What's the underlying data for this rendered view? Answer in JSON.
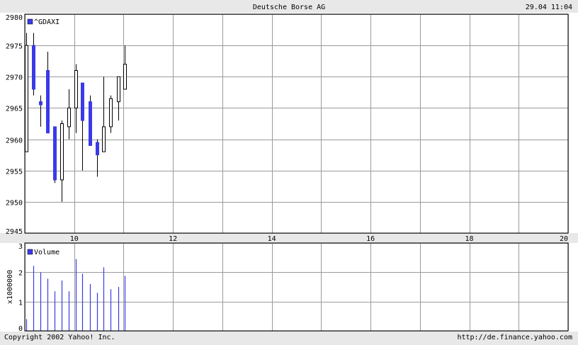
{
  "header": {
    "title": "Deutsche Borse AG",
    "datetime": "29.04 11:04"
  },
  "footer": {
    "copyright": "Copyright 2002 Yahoo! Inc.",
    "url": "http://de.finance.yahoo.com"
  },
  "colors": {
    "bear": "#3a3ae8",
    "bull": "#ffffff",
    "volume": "#3a3ae8",
    "grid": "#9a9a9a",
    "band": "#e8e8e8"
  },
  "chart_data": [
    {
      "type": "candlestick",
      "legend": "^GDAXI",
      "legend_placement": "top-left",
      "grid": true,
      "xlim": [
        9.0,
        20.0
      ],
      "ylim": [
        2945,
        2980
      ],
      "x_ticks": [
        10,
        12,
        14,
        16,
        18,
        20
      ],
      "y_ticks": [
        2945,
        2950,
        2955,
        2960,
        2965,
        2970,
        2975,
        2980
      ],
      "candles": [
        {
          "t": 9.0,
          "o": 2958,
          "h": 2977,
          "l": 2958,
          "c": 2975
        },
        {
          "t": 9.14,
          "o": 2975,
          "h": 2977,
          "l": 2967,
          "c": 2968
        },
        {
          "t": 9.29,
          "o": 2966,
          "h": 2967,
          "l": 2962,
          "c": 2965.5
        },
        {
          "t": 9.43,
          "o": 2971,
          "h": 2974,
          "l": 2961,
          "c": 2961
        },
        {
          "t": 9.57,
          "o": 2962,
          "h": 2962,
          "l": 2953,
          "c": 2953.5
        },
        {
          "t": 9.71,
          "o": 2953.5,
          "h": 2963,
          "l": 2950,
          "c": 2962.5
        },
        {
          "t": 9.86,
          "o": 2962,
          "h": 2968,
          "l": 2960,
          "c": 2965
        },
        {
          "t": 10.0,
          "o": 2965,
          "h": 2972,
          "l": 2961,
          "c": 2971
        },
        {
          "t": 10.14,
          "o": 2969,
          "h": 2969,
          "l": 2955,
          "c": 2963
        },
        {
          "t": 10.29,
          "o": 2966,
          "h": 2967,
          "l": 2959,
          "c": 2959
        },
        {
          "t": 10.43,
          "o": 2959.5,
          "h": 2960,
          "l": 2954,
          "c": 2957.5
        },
        {
          "t": 10.57,
          "o": 2958,
          "h": 2970,
          "l": 2958,
          "c": 2962
        },
        {
          "t": 10.71,
          "o": 2962,
          "h": 2967,
          "l": 2961,
          "c": 2966.5
        },
        {
          "t": 10.86,
          "o": 2966,
          "h": 2970,
          "l": 2963,
          "c": 2970
        },
        {
          "t": 11.0,
          "o": 2968,
          "h": 2975,
          "l": 2968,
          "c": 2972
        }
      ]
    },
    {
      "type": "bar",
      "legend": "Volume",
      "legend_placement": "top-left",
      "ylabel": "x1000000",
      "grid": true,
      "xlim": [
        9.0,
        20.0
      ],
      "ylim": [
        0,
        3
      ],
      "y_ticks": [
        0,
        1,
        2,
        3
      ],
      "x": [
        9.0,
        9.14,
        9.29,
        9.43,
        9.57,
        9.71,
        9.86,
        10.0,
        10.14,
        10.29,
        10.43,
        10.57,
        10.71,
        10.86,
        11.0
      ],
      "values": [
        0.4,
        2.22,
        2.0,
        1.78,
        1.35,
        1.72,
        1.35,
        2.45,
        1.95,
        1.6,
        1.3,
        2.17,
        1.42,
        1.5,
        1.88
      ]
    }
  ]
}
